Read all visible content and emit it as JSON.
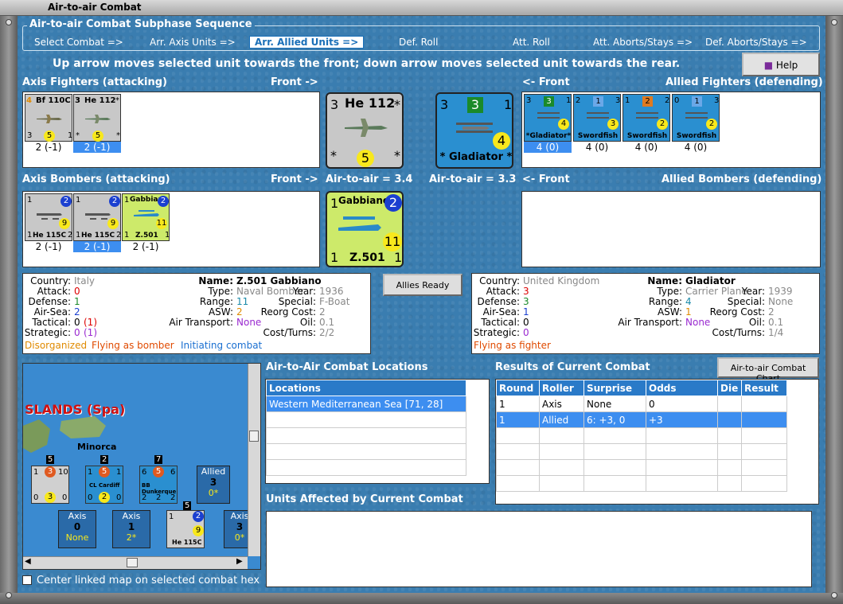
{
  "window": {
    "title": "Air-to-air Combat"
  },
  "sequence": {
    "title": "Air-to-air Combat Subphase Sequence",
    "steps": [
      "Select Combat =>",
      "Arr. Axis Units =>",
      "Arr. Allied Units =>",
      "Def. Roll",
      "Att. Roll",
      "Att. Aborts/Stays =>",
      "Def. Aborts/Stays =>"
    ],
    "active_index": 2
  },
  "instruction": "Up arrow moves selected unit towards the front; down arrow moves selected unit towards the rear.",
  "help_label": "Help",
  "axis_fighters": {
    "label": "Axis Fighters (attacking)",
    "front": "Front ->",
    "units": [
      {
        "name": "Bf 110C",
        "top_left": "4",
        "top_right": "1",
        "bl": "3",
        "br": "1",
        "dot": "5",
        "under": "2 (-1)",
        "selected": false
      },
      {
        "name": "He 112",
        "top_left": "3",
        "top_right": "*",
        "bl": "*",
        "br": "*",
        "dot": "5",
        "under": "2 (-1)",
        "selected": true
      }
    ]
  },
  "allied_fighters": {
    "label": "Allied Fighters (defending)",
    "front": "<- Front",
    "units": [
      {
        "name": "*Gladiator*",
        "top_left": "3",
        "sq": "3",
        "top_right": "1",
        "dot": "4",
        "under": "4 (0)",
        "selected": true
      },
      {
        "name": "Swordfish",
        "top_left": "2",
        "sq": "1",
        "top_right": "3",
        "dot": "3",
        "under": "4 (0)",
        "selected": false
      },
      {
        "name": "Swordfish",
        "top_left": "1",
        "sq": "2",
        "top_right": "2",
        "dot": "2",
        "under": "4 (0)",
        "selected": false
      },
      {
        "name": "Swordfish",
        "top_left": "0",
        "sq": "1",
        "top_right": "3",
        "dot": "2",
        "under": "4 (0)",
        "selected": false
      }
    ]
  },
  "axis_bombers": {
    "label": "Axis Bombers (attacking)",
    "front": "Front ->",
    "units": [
      {
        "name": "He 115C",
        "top_left": "1",
        "dot_top": "2",
        "dot": "9",
        "bl": "1",
        "br": "2",
        "under": "2 (-1)",
        "selected": false
      },
      {
        "name": "He 115C",
        "top_left": "1",
        "dot_top": "2",
        "dot": "9",
        "bl": "1",
        "br": "2",
        "under": "2 (-1)",
        "selected": true
      },
      {
        "name": "Z.501",
        "top_left": "1",
        "dot_top": "2",
        "dot": "11",
        "bl": "1",
        "br": "1",
        "title": "Gabbiano",
        "under": "2 (-1)",
        "selected": false
      }
    ]
  },
  "allied_bombers": {
    "label": "Allied Bombers (defending)",
    "front": "<- Front"
  },
  "big_axis_fighter": {
    "name": "He 112",
    "tl": "3",
    "tr": "*",
    "bl": "*",
    "br": "*",
    "dot": "5",
    "a2a": "Air-to-air = 3.4"
  },
  "big_allied_fighter": {
    "name": "* Gladiator *",
    "tl": "3",
    "sq": "3",
    "tr": "1",
    "dot": "4",
    "a2a": "Air-to-air = 3.3"
  },
  "big_axis_bomber": {
    "title": "Gabbiano",
    "name": "Z.501",
    "tl": "1",
    "dot_top": "2",
    "dot": "11",
    "bl": "1",
    "br": "1"
  },
  "allies_ready": "Allies Ready",
  "axis_info": {
    "country_k": "Country:",
    "country_v": "Italy",
    "attack_k": "Attack:",
    "attack_v": "0",
    "defense_k": "Defense:",
    "defense_v": "1",
    "airsea_k": "Air-Sea:",
    "airsea_v": "2",
    "tactical_k": "Tactical:",
    "tactical_v": "0",
    "tactical_x": "(1)",
    "strategic_k": "Strategic:",
    "strategic_v": "0",
    "strategic_x": "(1)",
    "name_k": "Name:",
    "name_v": "Z.501 Gabbiano",
    "type_k": "Type:",
    "type_v": "Naval Bomber",
    "range_k": "Range:",
    "range_v": "11",
    "asw_k": "ASW:",
    "asw_v": "2",
    "airtransport_k": "Air Transport:",
    "airtransport_v": "None",
    "year_k": "Year:",
    "year_v": "1936",
    "special_k": "Special:",
    "special_v": "F-Boat",
    "reorg_k": "Reorg Cost:",
    "reorg_v": "2",
    "oil_k": "Oil:",
    "oil_v": "0.1",
    "cost_k": "Cost/Turns:",
    "cost_v": "2/2",
    "status1": "Disorganized",
    "status2": "Flying as bomber",
    "status3": "Initiating combat"
  },
  "allied_info": {
    "country_k": "Country:",
    "country_v": "United Kingdom",
    "attack_k": "Attack:",
    "attack_v": "3",
    "defense_k": "Defense:",
    "defense_v": "3",
    "airsea_k": "Air-Sea:",
    "airsea_v": "1",
    "tactical_k": "Tactical:",
    "tactical_v": "0",
    "strategic_k": "Strategic:",
    "strategic_v": "0",
    "name_k": "Name:",
    "name_v": "Gladiator",
    "type_k": "Type:",
    "type_v": "Carrier Plane",
    "range_k": "Range:",
    "range_v": "4",
    "asw_k": "ASW:",
    "asw_v": "1",
    "airtransport_k": "Air Transport:",
    "airtransport_v": "None",
    "year_k": "Year:",
    "year_v": "1939",
    "special_k": "Special:",
    "special_v": "None",
    "reorg_k": "Reorg Cost:",
    "reorg_v": "2",
    "oil_k": "Oil:",
    "oil_v": "0.1",
    "cost_k": "Cost/Turns:",
    "cost_v": "1/4",
    "status1": "Flying as fighter"
  },
  "minimap": {
    "region": "SLANDS (Spa)",
    "island": "Minorca",
    "stacks": [
      {
        "count": "5",
        "a": "1",
        "b": "3",
        "c": "10",
        "d": "0",
        "e": "3",
        "f": "0"
      },
      {
        "count": "2",
        "name": "CL Cardiff",
        "a": "1",
        "b": "5",
        "c": "1",
        "d": "0",
        "e": "2",
        "f": "0"
      },
      {
        "count": "7",
        "name": "BB Dunkerque",
        "a": "6",
        "b": "5",
        "c": "6",
        "d": "2",
        "e": "2",
        "f": "2"
      }
    ],
    "allied_box": {
      "label": "Allied",
      "num": "3",
      "sub": "0*"
    },
    "axis_boxes": [
      {
        "label": "Axis",
        "num": "0",
        "sub": "None"
      },
      {
        "label": "Axis",
        "num": "1",
        "sub": "2*"
      },
      {
        "label": "Axis",
        "num": "3",
        "sub": "0*"
      }
    ],
    "bomber_stack": {
      "count": "5",
      "name": "He 115C",
      "dot": "2",
      "dot2": "9",
      "tl": "1"
    },
    "center_checkbox": "Center linked map on selected combat hex"
  },
  "locations": {
    "title": "Air-to-Air Combat Locations",
    "header": "Locations",
    "rows": [
      "Western Mediterranean Sea [71, 28]"
    ]
  },
  "results": {
    "title": "Results of Current Combat",
    "chart_button": "Air-to-air Combat Chart",
    "headers": [
      "Round",
      "Roller",
      "Surprise",
      "Odds",
      "Die",
      "Result"
    ],
    "rows": [
      [
        "1",
        "Axis",
        "None",
        "0",
        "",
        ""
      ],
      [
        "1",
        "Allied",
        "6: +3, 0",
        "+3",
        "",
        ""
      ]
    ],
    "selected_row": 1
  },
  "units_affected": {
    "title": "Units Affected by Current Combat"
  },
  "colors": {
    "accent": "#3d8ef0",
    "sea": "#3a7db0",
    "disorganized": "#e08a00",
    "flying": "#e04a00",
    "initiating": "#1a6fd0"
  }
}
